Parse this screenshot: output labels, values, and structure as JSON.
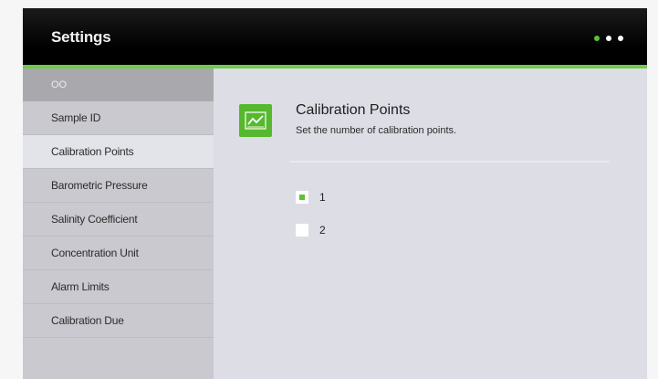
{
  "header": {
    "title": "Settings",
    "page_dots": [
      {
        "name": "page-dot-1",
        "active": true
      },
      {
        "name": "page-dot-2",
        "active": false
      },
      {
        "name": "page-dot-3",
        "active": false
      }
    ],
    "accent_color": "#6fcb4a"
  },
  "sidebar": {
    "header_label": "OO",
    "items": [
      {
        "label": "Sample ID",
        "selected": false
      },
      {
        "label": "Calibration Points",
        "selected": true
      },
      {
        "label": "Barometric Pressure",
        "selected": false
      },
      {
        "label": "Salinity Coefficient",
        "selected": false
      },
      {
        "label": "Concentration Unit",
        "selected": false
      },
      {
        "label": "Alarm Limits",
        "selected": false
      },
      {
        "label": "Calibration Due",
        "selected": false
      }
    ]
  },
  "main": {
    "icon": "chart-line-icon",
    "title": "Calibration Points",
    "subtitle": "Set the number of calibration points.",
    "options": [
      {
        "label": "1",
        "selected": true
      },
      {
        "label": "2",
        "selected": false
      }
    ]
  }
}
